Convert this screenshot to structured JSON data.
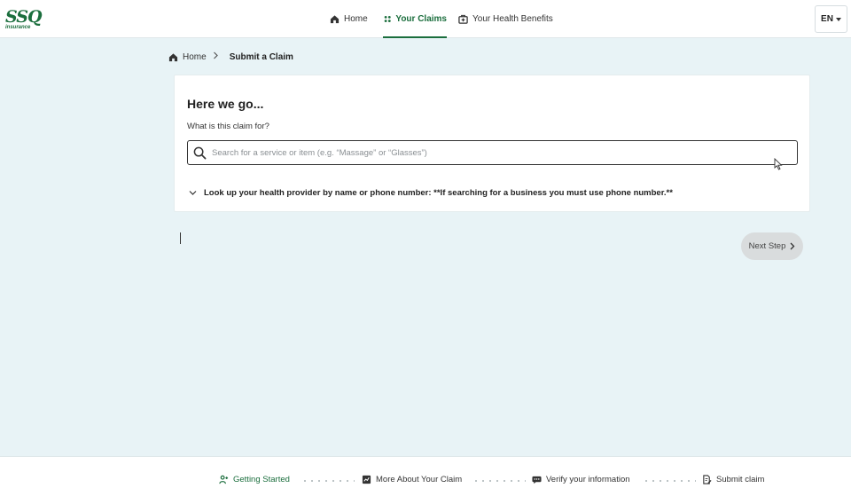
{
  "brand": {
    "logo_mark": "SSQ",
    "logo_sub": "insurance",
    "color": "#1b6e3d"
  },
  "nav": {
    "items": [
      {
        "label": "Home",
        "icon": "home-icon",
        "active": false
      },
      {
        "label": "Your Claims",
        "icon": "claims-grid-icon",
        "active": true
      },
      {
        "label": "Your Health Benefits",
        "icon": "health-benefits-icon",
        "active": false
      }
    ],
    "language": "EN"
  },
  "breadcrumb": {
    "home": "Home",
    "current": "Submit a Claim"
  },
  "claim_card": {
    "title": "Here we go...",
    "question": "What is this claim for?",
    "search_placeholder": "Search for a service or item (e.g. “Massage” or “Glasses”)",
    "search_value": "",
    "provider_lookup": "Look up your health provider by name or phone number: **If searching for a business you must use phone number.**"
  },
  "actions": {
    "next_step": "Next Step"
  },
  "steps": [
    {
      "label": "Getting Started",
      "icon": "getting-started-icon",
      "active": true
    },
    {
      "label": "More About Your Claim",
      "icon": "claim-details-icon",
      "active": false
    },
    {
      "label": "Verify your information",
      "icon": "chat-bubble-icon",
      "active": false
    },
    {
      "label": "Submit claim",
      "icon": "submit-document-icon",
      "active": false
    }
  ]
}
